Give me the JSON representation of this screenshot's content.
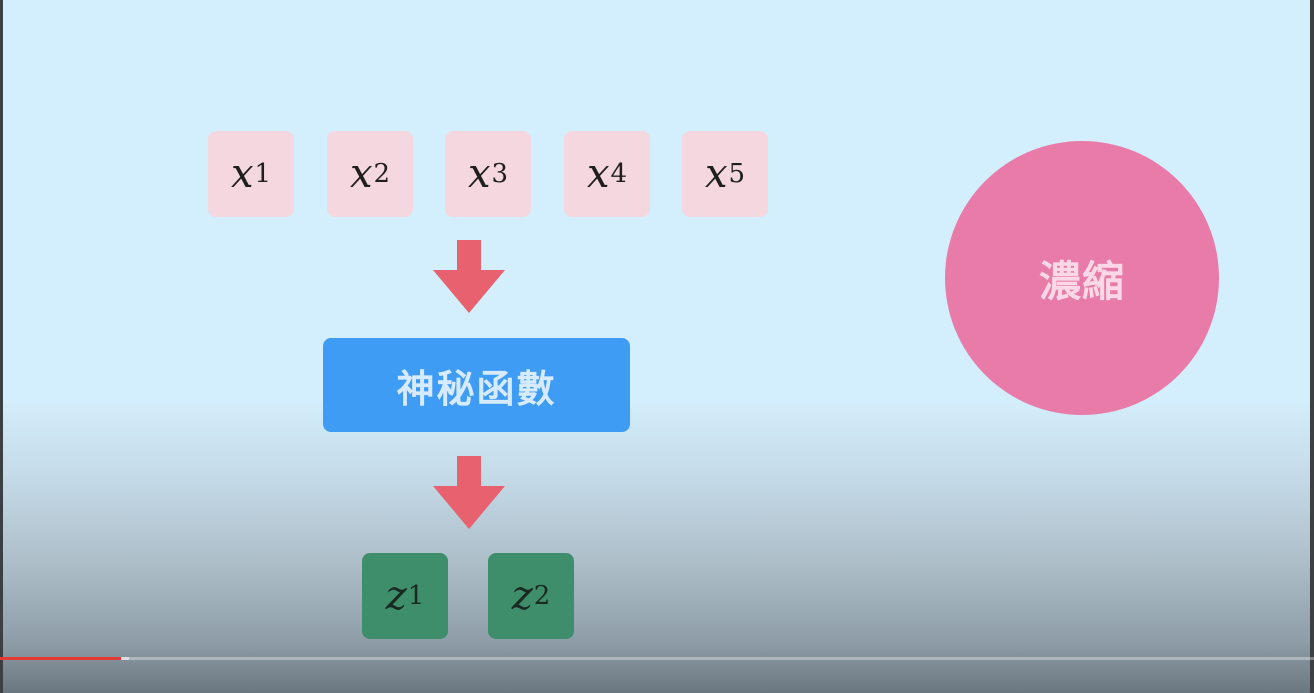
{
  "inputs": [
    {
      "var": "x",
      "sub": "1"
    },
    {
      "var": "x",
      "sub": "2"
    },
    {
      "var": "x",
      "sub": "3"
    },
    {
      "var": "x",
      "sub": "4"
    },
    {
      "var": "x",
      "sub": "5"
    }
  ],
  "function_label": "神秘函數",
  "outputs": [
    {
      "var": "z",
      "sub": "1"
    },
    {
      "var": "z",
      "sub": "2"
    }
  ],
  "circle_label": "濃縮",
  "colors": {
    "input_box": "#f5d8df",
    "function_box": "#3f9cf5",
    "output_box": "#3f8e6b",
    "arrow": "#e8616e",
    "circle": "#e97ba8",
    "progress": "#e53935"
  },
  "video_progress": 0.092
}
